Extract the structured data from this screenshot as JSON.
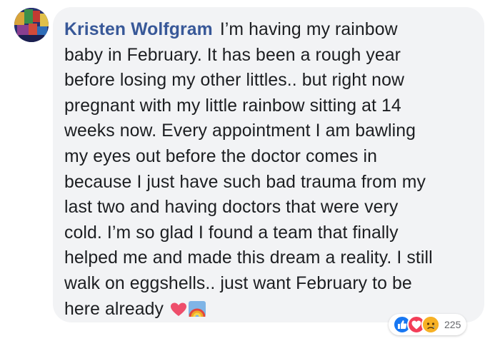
{
  "comment": {
    "author": "Kristen Wolfgram",
    "text": "I’m having my rainbow\nbaby in February. It has been a rough year\nbefore losing my other littles.. but right now\npregnant with my little rainbow sitting at 14\nweeks now. Every appointment I am bawling\nmy eyes out before the doctor comes in\nbecause I just have such bad trauma from my\nlast two and having doctors that were very\ncold. I’m so glad I found a team that finally\nhelped me and made this dream a reality. I still\nwalk on eggshells.. just want February to be\nhere already",
    "emojis": [
      "heart-emoji",
      "rainbow-emoji"
    ],
    "avatar_icon": "profile-avatar"
  },
  "reactions": {
    "icons": [
      "like-icon",
      "love-icon",
      "sad-icon"
    ],
    "count": "225"
  },
  "colors": {
    "bubble": "#f2f3f5",
    "author": "#385898",
    "text": "#1c1e21",
    "like": "#1877f2",
    "love": "#f33e58",
    "sad": "#f7b125"
  }
}
